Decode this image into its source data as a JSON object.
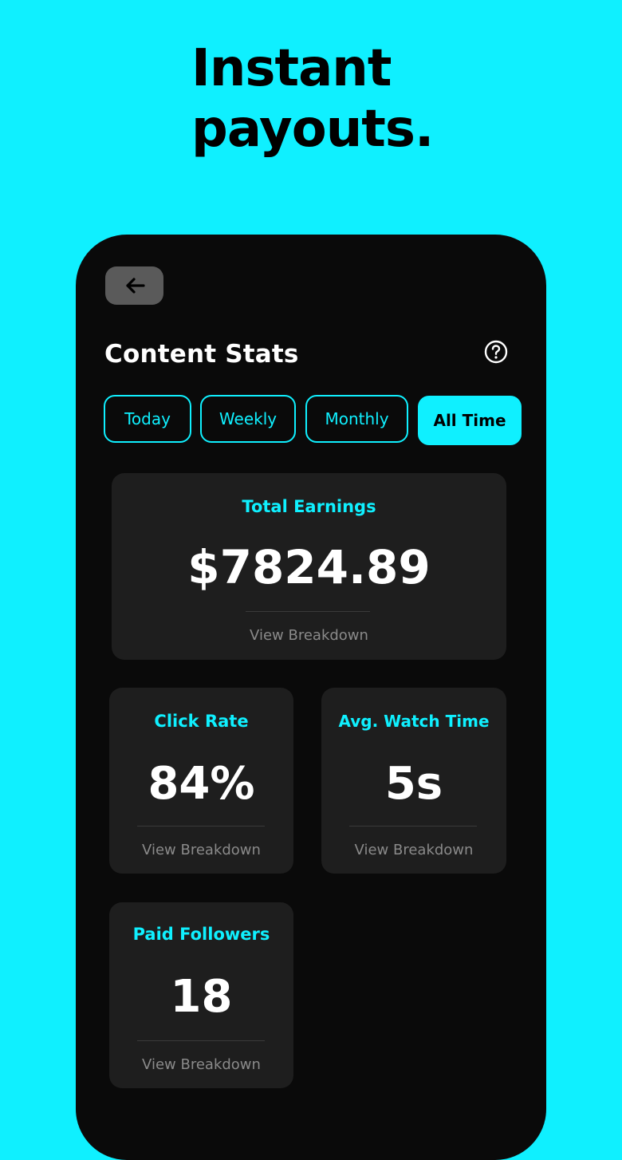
{
  "headline": {
    "line1": "Instant",
    "line2": "payouts."
  },
  "header": {
    "back_icon": "arrow-left-icon",
    "title": "Content Stats",
    "help_icon": "question-circle-icon"
  },
  "tabs": [
    {
      "label": "Today",
      "active": false
    },
    {
      "label": "Weekly",
      "active": false
    },
    {
      "label": "Monthly",
      "active": false
    },
    {
      "label": "All Time",
      "active": true
    }
  ],
  "cards": {
    "total_earnings": {
      "title": "Total Earnings",
      "value": "$7824.89",
      "link": "View Breakdown"
    },
    "click_rate": {
      "title": "Click Rate",
      "value": "84%",
      "link": "View Breakdown"
    },
    "avg_watch_time": {
      "title": "Avg. Watch Time",
      "value": "5s",
      "link": "View Breakdown"
    },
    "paid_followers": {
      "title": "Paid Followers",
      "value": "18",
      "link": "View Breakdown"
    }
  },
  "colors": {
    "background": "#0ff0ff",
    "accent": "#0ff0ff",
    "phone": "#0a0a0a",
    "card": "#1e1e1e",
    "back_button": "#5a5a5a"
  }
}
